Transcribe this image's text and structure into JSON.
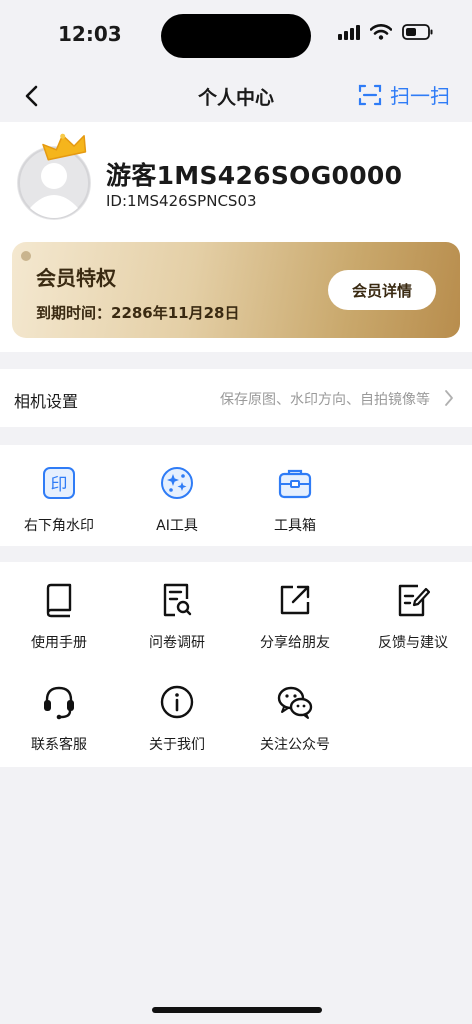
{
  "status_bar": {
    "time": "12:03",
    "battery_icon": "battery-icon",
    "wifi_icon": "wifi-icon",
    "signal_icon": "signal-icon"
  },
  "nav": {
    "title": "个人中心",
    "scan_label": "扫一扫",
    "accent": "#2f7cf6"
  },
  "profile": {
    "username": "游客1MS426SOG0000",
    "id": "ID:1MS426SPNCS03"
  },
  "vip": {
    "title": "会员特权",
    "expiry": "到期时间：2286年11月28日",
    "details_label": "会员详情"
  },
  "camera_settings": {
    "label": "相机设置",
    "description": "保存原图、水印方向、自拍镜像等"
  },
  "tools": [
    {
      "label": "右下角水印",
      "icon": "watermark-icon"
    },
    {
      "label": "AI工具",
      "icon": "ai-sparkle-icon"
    },
    {
      "label": "工具箱",
      "icon": "toolbox-icon"
    }
  ],
  "features": [
    {
      "label": "使用手册",
      "icon": "book-icon"
    },
    {
      "label": "问卷调研",
      "icon": "survey-icon"
    },
    {
      "label": "分享给朋友",
      "icon": "share-icon"
    },
    {
      "label": "反馈与建议",
      "icon": "feedback-icon"
    },
    {
      "label": "联系客服",
      "icon": "headset-icon"
    },
    {
      "label": "关于我们",
      "icon": "info-icon"
    },
    {
      "label": "关注公众号",
      "icon": "wechat-icon"
    }
  ]
}
